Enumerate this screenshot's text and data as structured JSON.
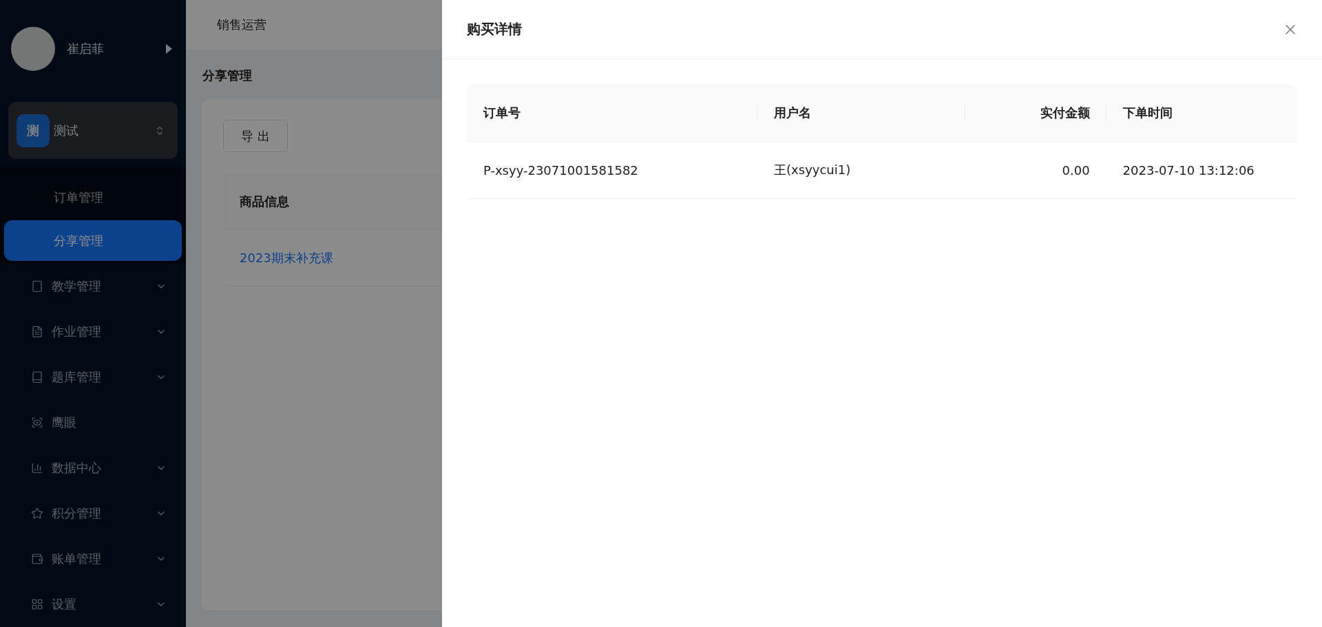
{
  "sidebar": {
    "user": {
      "name": "崔启菲"
    },
    "workspace": {
      "badge": "测",
      "name": "测试"
    },
    "submenu": [
      {
        "label": "订单管理",
        "selected": false
      },
      {
        "label": "分享管理",
        "selected": true
      }
    ],
    "menu": [
      {
        "label": "教学管理",
        "expandable": true
      },
      {
        "label": "作业管理",
        "expandable": true
      },
      {
        "label": "题库管理",
        "expandable": true
      },
      {
        "label": "鹰眼",
        "expandable": false
      },
      {
        "label": "数据中心",
        "expandable": true
      },
      {
        "label": "积分管理",
        "expandable": true
      },
      {
        "label": "账单管理",
        "expandable": true
      },
      {
        "label": "设置",
        "expandable": true
      }
    ]
  },
  "topbar": {
    "title": "销售运营"
  },
  "page": {
    "title": "分享管理",
    "export_button": "导 出",
    "table": {
      "columns": [
        "商品信息"
      ],
      "rows": [
        [
          "2023期末补充课"
        ]
      ]
    }
  },
  "drawer": {
    "title": "购买详情",
    "table": {
      "columns": [
        {
          "label": "订单号",
          "kind": "text"
        },
        {
          "label": "用户名",
          "kind": "text"
        },
        {
          "label": "实付金额",
          "kind": "amount"
        },
        {
          "label": "下单时间",
          "kind": "text"
        }
      ],
      "rows": [
        [
          "P-xsyy-23071001581582",
          "王(xsyycui1)",
          "0.00",
          "2023-07-10 13:12:06"
        ]
      ]
    }
  }
}
